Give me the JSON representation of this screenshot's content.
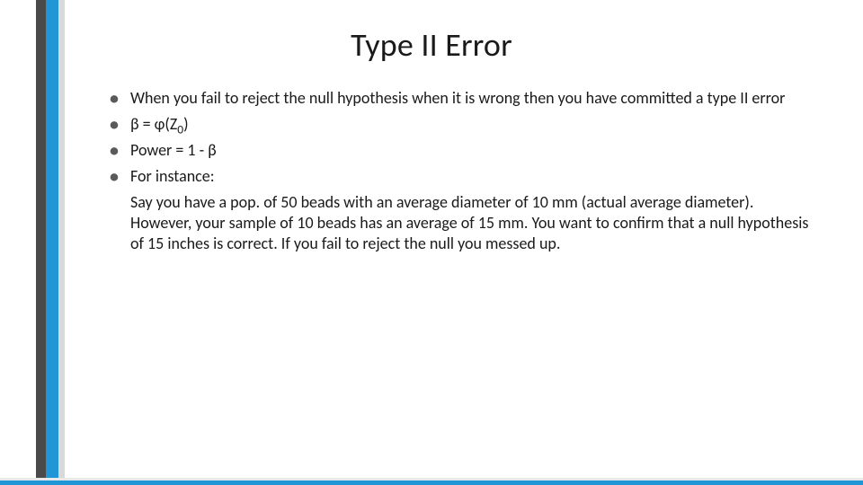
{
  "title": "Type II Error",
  "bullets": {
    "b1": "When you fail to reject the null hypothesis when it is wrong then you have committed a type II error",
    "b2_pre": "β = φ(Z",
    "b2_sub": "0",
    "b2_post": ")",
    "b3": "Power = 1 - β",
    "b4": "For instance:"
  },
  "example": "Say you have a pop. of 50 beads with an average diameter of 10 mm (actual average diameter). However, your sample of 10 beads has an average of 15 mm.  You want to confirm that a null hypothesis of 15 inches is correct. If you fail to reject the null you messed up."
}
